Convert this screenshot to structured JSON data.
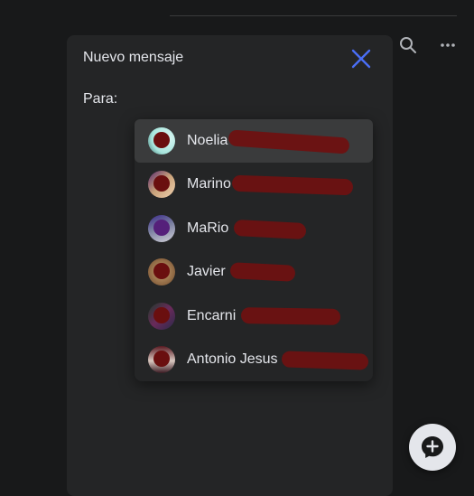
{
  "dialog": {
    "title": "Nuevo mensaje",
    "to_label": "Para:"
  },
  "icons": {
    "search": "search-icon",
    "more": "more-horizontal-icon",
    "close": "close-icon",
    "new_message": "new-message-icon"
  },
  "colors": {
    "accent": "#4a6ef5",
    "background": "#18191a",
    "dialog": "#242526",
    "highlight": "#3a3b3c",
    "redaction": "#6e1111"
  },
  "suggestions": [
    {
      "name": "Noelia",
      "selected": true
    },
    {
      "name": "Marino",
      "selected": false
    },
    {
      "name": "MaRio",
      "selected": false
    },
    {
      "name": "Javier",
      "selected": false
    },
    {
      "name": "Encarni",
      "selected": false
    },
    {
      "name": "Antonio Jesus",
      "selected": false
    }
  ]
}
